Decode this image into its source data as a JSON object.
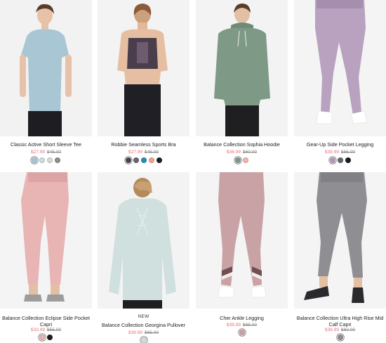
{
  "products": [
    {
      "name": "Classic Active Short Sleeve Tee",
      "sale_price": "$27.99",
      "orig_price": "$45.00",
      "swatches": [
        "#a7c7d8",
        "#c9dee0",
        "#d9d9d9",
        "#8a9089"
      ],
      "selected": 0
    },
    {
      "name": "Robbie Seamless Sports Bra",
      "sale_price": "$27.99",
      "orig_price": "$45.00",
      "swatches": [
        "#4b4250",
        "#6b6570",
        "#2a8db5",
        "#f1a38f",
        "#1f1f22"
      ],
      "selected": 0
    },
    {
      "name": "Balance Collection Sophia Hoodie",
      "sale_price": "$36.99",
      "orig_price": "$60.00",
      "swatches": [
        "#7e9a86",
        "#f0b6ad"
      ],
      "selected": 0
    },
    {
      "name": "Gear-Up Side Pocket Legging",
      "sale_price": "$39.99",
      "orig_price": "$65.00",
      "swatches": [
        "#b29ab8",
        "#5e6a6a",
        "#1b1b1d"
      ],
      "selected": 0
    },
    {
      "name": "Balance Collection Eclipse Side Pocket Capri",
      "sale_price": "$33.99",
      "orig_price": "$55.00",
      "swatches": [
        "#e9b3b3",
        "#1f1f22"
      ],
      "selected": 0
    },
    {
      "name": "Balance Collection Georgina Pullover",
      "tag": "NEW",
      "sale_price": "$39.99",
      "orig_price": "$65.00",
      "swatches": [
        "#cfe0de"
      ],
      "selected": 0
    },
    {
      "name": "Cher Ankle Legging",
      "sale_price": "$39.99",
      "orig_price": "$65.00",
      "swatches": [
        "#c9a2a6"
      ],
      "selected": 0
    },
    {
      "name": "Balance Collection Ultra High Rise Mid Calf Capri",
      "sale_price": "$36.99",
      "orig_price": "$60.00",
      "swatches": [
        "#8f8f93"
      ],
      "selected": 0
    }
  ]
}
